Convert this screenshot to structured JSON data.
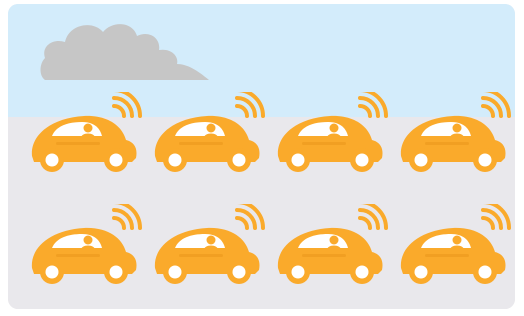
{
  "scene": {
    "colors": {
      "sky": "#d3ecfb",
      "ground": "#e9e8ec",
      "cloud": "#c6c6c6",
      "car_body": "#faaa2b",
      "car_dark": "#e08b12",
      "window": "#ffffff",
      "driver": "#faaa2b",
      "wheel": "#ffffff",
      "signal": "#faaa2b"
    },
    "icons": {
      "cloud": "cloud-icon",
      "car": "connected-car-icon",
      "signal": "wireless-signal-icon"
    },
    "rows": [
      {
        "cars": [
          {
            "id": "car-1"
          },
          {
            "id": "car-2"
          },
          {
            "id": "car-3"
          },
          {
            "id": "car-4"
          }
        ]
      },
      {
        "cars": [
          {
            "id": "car-5"
          },
          {
            "id": "car-6"
          },
          {
            "id": "car-7"
          },
          {
            "id": "car-8"
          }
        ]
      }
    ]
  }
}
